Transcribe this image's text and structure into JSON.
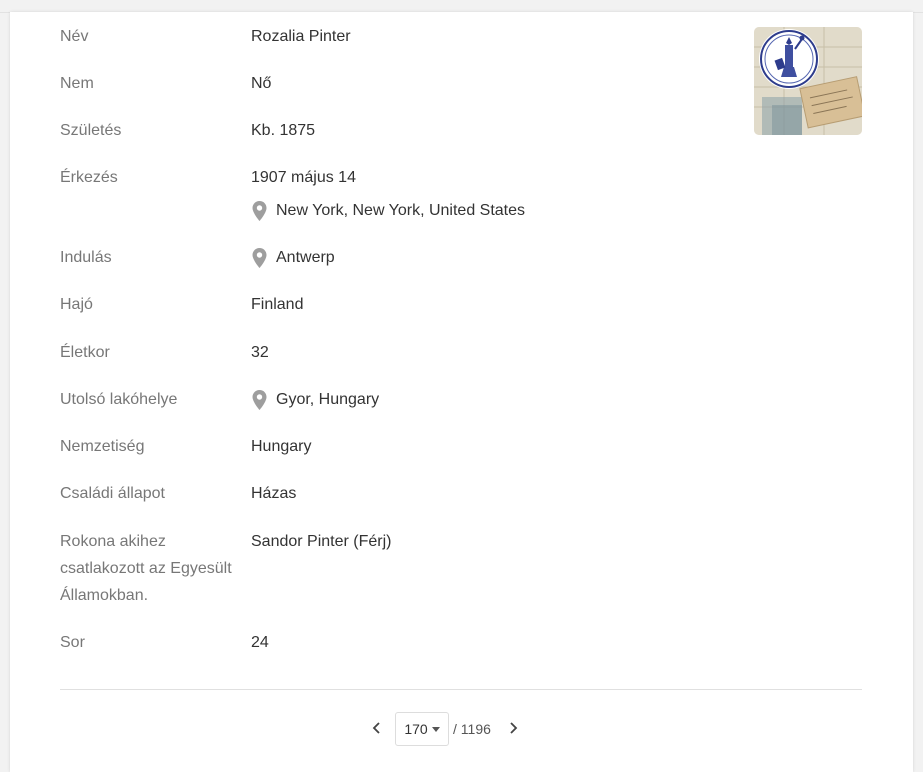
{
  "record": {
    "name_label": "Név",
    "name_value": "Rozalia Pinter",
    "gender_label": "Nem",
    "gender_value": "Nő",
    "birth_label": "Születés",
    "birth_value": "Kb. 1875",
    "arrival_label": "Érkezés",
    "arrival_date": "1907 május 14",
    "arrival_place": "New York, New York, United States",
    "departure_label": "Indulás",
    "departure_place": "Antwerp",
    "ship_label": "Hajó",
    "ship_value": "Finland",
    "age_label": "Életkor",
    "age_value": "32",
    "residence_label": "Utolsó lakóhelye",
    "residence_place": "Gyor, Hungary",
    "nationality_label": "Nemzetiség",
    "nationality_value": "Hungary",
    "marital_label": "Családi állapot",
    "marital_value": "Házas",
    "relative_label": "Rokona akihez csatlakozott az Egyesült Államokban.",
    "relative_value": "Sandor Pinter (Férj)",
    "line_label": "Sor",
    "line_value": "24"
  },
  "pager": {
    "current": "170",
    "total": "/ 1196"
  },
  "icons": {
    "pin": "map-pin-icon",
    "prev": "chevron-left-icon",
    "next": "chevron-right-icon",
    "caret": "caret-down-icon"
  },
  "colors": {
    "label": "#777777",
    "value": "#333333",
    "pin": "#9e9e9e"
  }
}
